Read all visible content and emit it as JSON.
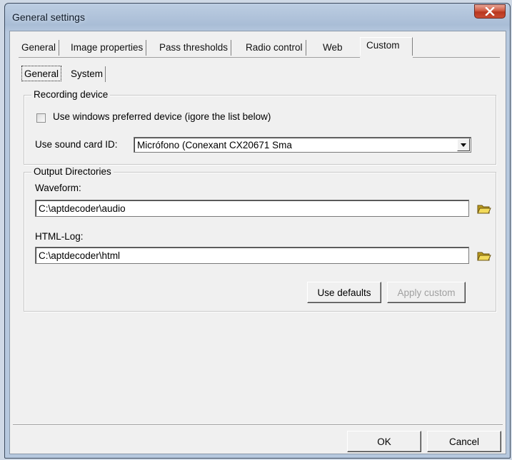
{
  "window": {
    "title": "General settings"
  },
  "tabs": [
    {
      "label": "General"
    },
    {
      "label": "Image properties"
    },
    {
      "label": "Pass thresholds"
    },
    {
      "label": "Radio control"
    },
    {
      "label": "Web"
    },
    {
      "label": "Custom",
      "active": true
    }
  ],
  "subtabs": [
    {
      "label": "General",
      "active": true
    },
    {
      "label": "System"
    }
  ],
  "recording": {
    "group_title": "Recording device",
    "checkbox_label": "Use windows preferred device (igore the list below)",
    "checkbox_checked": false,
    "soundcard_label": "Use sound card ID:",
    "soundcard_value": "Micrófono (Conexant CX20671 Sma"
  },
  "output": {
    "group_title": "Output Directories",
    "waveform_label": "Waveform:",
    "waveform_value": "C:\\aptdecoder\\audio",
    "htmllog_label": "HTML-Log:",
    "htmllog_value": "C:\\aptdecoder\\html",
    "use_defaults": "Use defaults",
    "apply_custom": "Apply custom"
  },
  "footer": {
    "ok": "OK",
    "cancel": "Cancel"
  },
  "icons": {
    "close": "close-icon",
    "folder": "folder-icon"
  }
}
